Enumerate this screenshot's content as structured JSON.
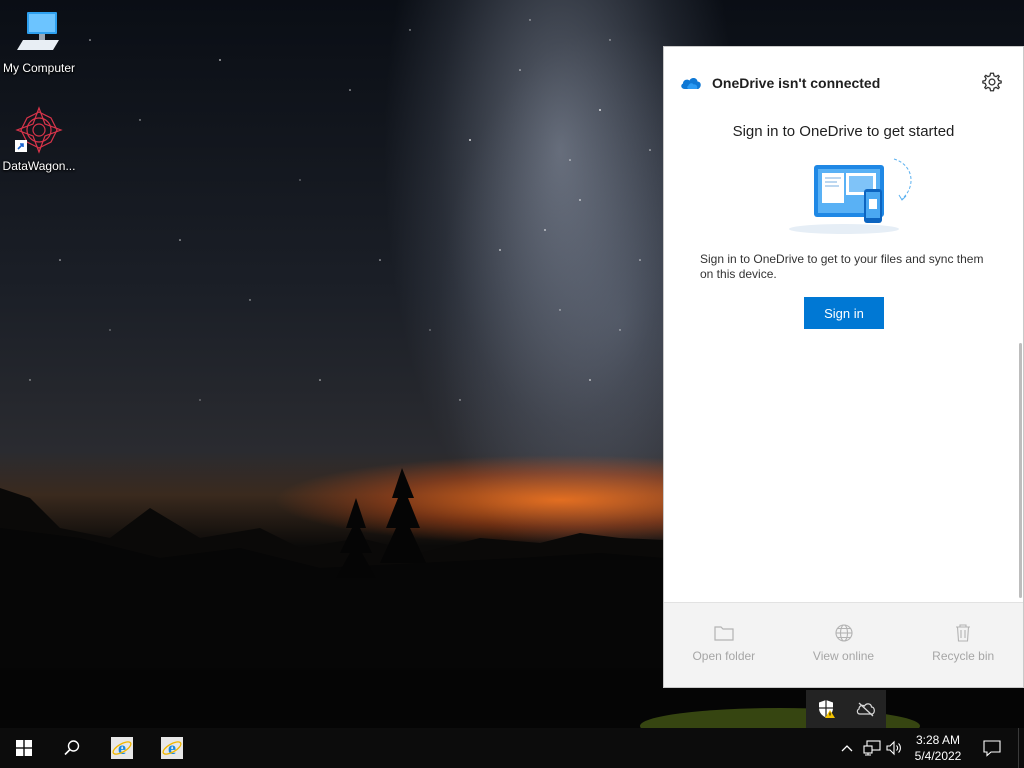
{
  "desktop": {
    "icons": [
      {
        "label": "My Computer",
        "icon": "computer-icon"
      },
      {
        "label": "DataWagon...",
        "icon": "datawagon-shortcut-icon"
      }
    ]
  },
  "onedrive": {
    "title": "OneDrive isn't connected",
    "heading": "Sign in to OneDrive to get started",
    "description": "Sign in to OneDrive to get to your files and sync them on this device.",
    "signin_label": "Sign in",
    "footer": {
      "open_folder": "Open folder",
      "view_online": "View online",
      "recycle_bin": "Recycle bin"
    },
    "colors": {
      "accent": "#0078d4",
      "disabled": "#a6a6a6"
    }
  },
  "taskbar": {
    "time": "3:28 AM",
    "date": "5/4/2022",
    "tray_icons": [
      "security-warning-icon",
      "onedrive-offline-icon"
    ],
    "system_icons": [
      "chevron-up-icon",
      "network-icon",
      "volume-icon",
      "action-center-icon"
    ]
  }
}
